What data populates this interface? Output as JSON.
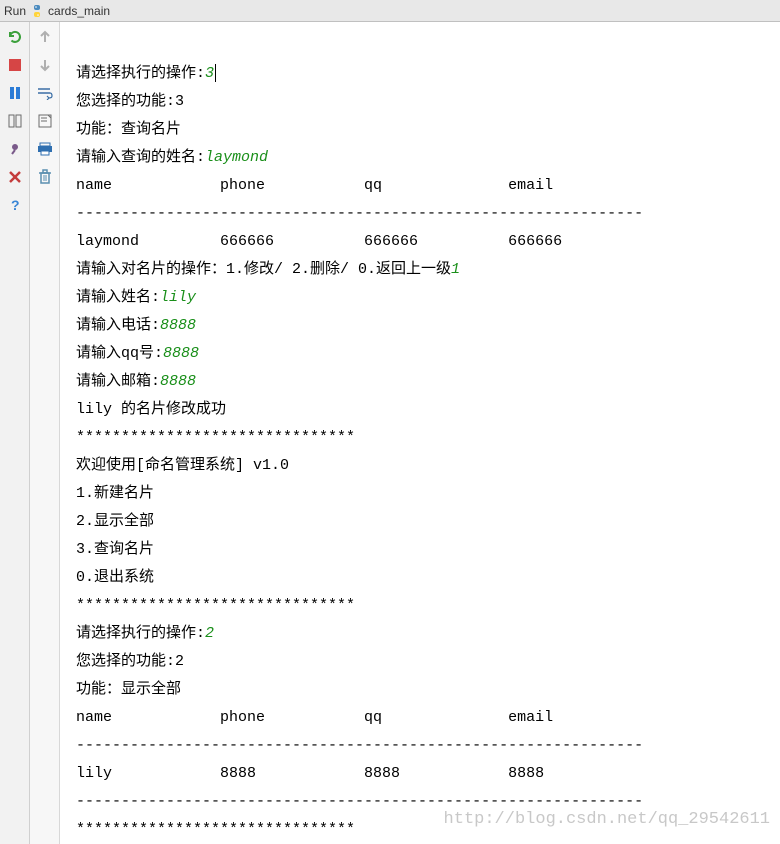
{
  "tab": {
    "run_label": "Run",
    "file_name": "cards_main"
  },
  "console": {
    "lines": [
      {
        "prompt": "请选择执行的操作:",
        "input": "3",
        "caret": true
      },
      {
        "prompt": "您选择的功能:3"
      },
      {
        "prompt": "功能：查询名片"
      },
      {
        "prompt": "请输入查询的姓名:",
        "input": "laymond"
      },
      {
        "prompt": "name            phone           qq              email"
      },
      {
        "prompt": "---------------------------------------------------------------"
      },
      {
        "prompt": "laymond         666666          666666          666666"
      },
      {
        "prompt": "请输入对名片的操作：1.修改/ 2.删除/ 0.返回上一级",
        "input": "1"
      },
      {
        "prompt": "请输入姓名:",
        "input": "lily"
      },
      {
        "prompt": "请输入电话:",
        "input": "8888"
      },
      {
        "prompt": "请输入qq号:",
        "input": "8888"
      },
      {
        "prompt": "请输入邮箱:",
        "input": "8888"
      },
      {
        "prompt": "lily 的名片修改成功"
      },
      {
        "prompt": "*******************************"
      },
      {
        "prompt": "欢迎使用[命名管理系统] v1.0"
      },
      {
        "prompt": ""
      },
      {
        "prompt": "1.新建名片"
      },
      {
        "prompt": "2.显示全部"
      },
      {
        "prompt": "3.查询名片"
      },
      {
        "prompt": ""
      },
      {
        "prompt": "0.退出系统"
      },
      {
        "prompt": "*******************************"
      },
      {
        "prompt": "请选择执行的操作:",
        "input": "2"
      },
      {
        "prompt": "您选择的功能:2"
      },
      {
        "prompt": "功能：显示全部"
      },
      {
        "prompt": "name            phone           qq              email"
      },
      {
        "prompt": "---------------------------------------------------------------"
      },
      {
        "prompt": "lily            8888            8888            8888"
      },
      {
        "prompt": "---------------------------------------------------------------"
      },
      {
        "prompt": "*******************************"
      }
    ]
  },
  "watermark": "http://blog.csdn.net/qq_29542611",
  "colors": {
    "user_input": "#1a8f1a",
    "rerun": "#3ba03b",
    "stop": "#d64545",
    "pause": "#2b7bd6",
    "close": "#c43c3c",
    "help": "#3a86d6",
    "print": "#2f6fb0",
    "trash": "#5a8fb0",
    "arrow_disabled": "#b0b0b0",
    "layout_icon": "#6b6b6b",
    "pin_icon": "#7a5a8a"
  }
}
